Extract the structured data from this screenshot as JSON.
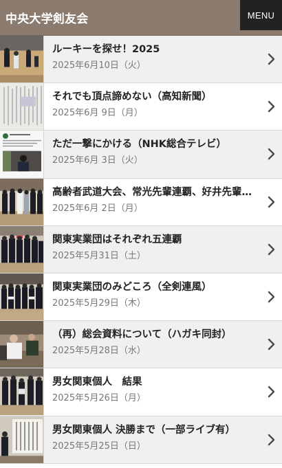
{
  "header": {
    "site_title": "中央大学剣友会",
    "menu_label": "MENU"
  },
  "posts": [
    {
      "title": "ルーキーを探せ！2025",
      "date": "2025年6月10日（火）",
      "thumb": "kendo-match-icon"
    },
    {
      "title": "それでも頂点諦めない（高知新聞）",
      "date": "2025年6月 9日（月）",
      "thumb": "newspaper-clipping-icon"
    },
    {
      "title": "ただ一撃にかける（NHK総合テレビ）",
      "date": "2025年6月 3日（火）",
      "thumb": "social-post-icon"
    },
    {
      "title": "高齢者武道大会、常光先輩連覇、好井先輩…",
      "date": "2025年6月 2日（月）",
      "thumb": "group-photo-icon"
    },
    {
      "title": "関東実業団はそれぞれ五連覇",
      "date": "2025年5月31日（土）",
      "thumb": "team-photo-icon"
    },
    {
      "title": "関東実業団のみどころ（全剣連風）",
      "date": "2025年5月29日（木）",
      "thumb": "kendo-team-icon"
    },
    {
      "title": "（再）総会資料について（ハガキ同封）",
      "date": "2025年5月28日（水）",
      "thumb": "meeting-photo-icon"
    },
    {
      "title": "男女関東個人　結果",
      "date": "2025年5月26日（月）",
      "thumb": "kendo-group-icon"
    },
    {
      "title": "男女関東個人 決勝まで（一部ライブ有）",
      "date": "2025年5月25日（日）",
      "thumb": "results-board-icon"
    }
  ],
  "colors": {
    "header_bg": "#8a7b6e",
    "menu_bg": "#222222",
    "row_alt_bg": "#f0f0f0",
    "title_text": "#222222",
    "date_text": "#777777"
  }
}
